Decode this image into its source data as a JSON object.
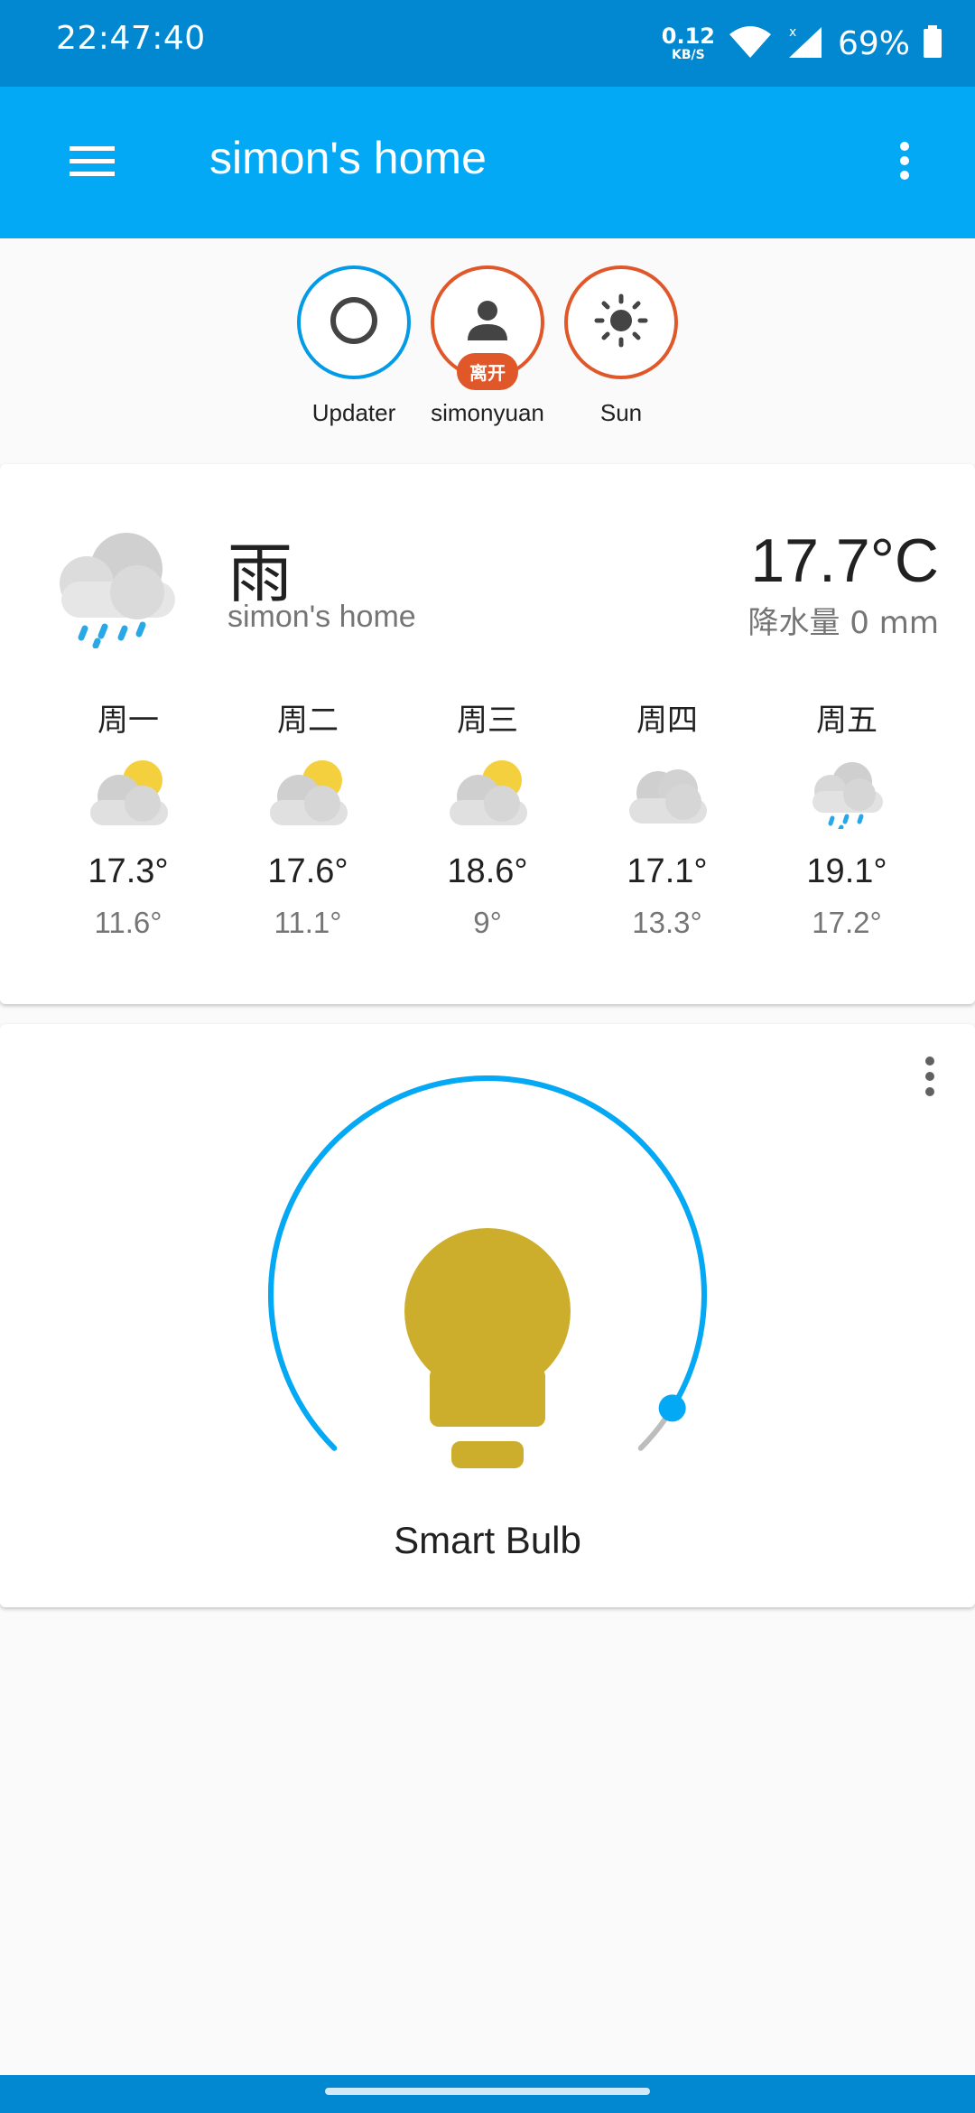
{
  "status_bar": {
    "time": "22:47:40",
    "net_speed_value": "0.12",
    "net_speed_unit": "KB/S",
    "battery_pct": "69%"
  },
  "app_bar": {
    "title": "simon's home",
    "menu_icon": "hamburger-menu-icon",
    "more_icon": "more-vertical-icon"
  },
  "badges": [
    {
      "label": "Updater",
      "icon": "circle-outline-icon",
      "border_color": "#039be5"
    },
    {
      "label": "simonyuan",
      "icon": "person-icon",
      "tag": "离开",
      "border_color": "#e0582a"
    },
    {
      "label": "Sun",
      "icon": "sun-icon",
      "border_color": "#e0582a"
    }
  ],
  "weather": {
    "condition": "雨",
    "location": "simon's home",
    "temperature": "17.7°C",
    "precipitation": "降水量 0 mm",
    "icon": "rain-cloud-icon",
    "forecast": [
      {
        "day": "周一",
        "high": "17.3°",
        "low": "11.6°",
        "icon": "partly-cloudy-icon"
      },
      {
        "day": "周二",
        "high": "17.6°",
        "low": "11.1°",
        "icon": "partly-cloudy-icon"
      },
      {
        "day": "周三",
        "high": "18.6°",
        "low": "9°",
        "icon": "partly-cloudy-icon"
      },
      {
        "day": "周四",
        "high": "17.1°",
        "low": "13.3°",
        "icon": "cloudy-icon"
      },
      {
        "day": "周五",
        "high": "19.1°",
        "low": "17.2°",
        "icon": "rain-cloud-icon"
      }
    ]
  },
  "light": {
    "name": "Smart Bulb",
    "icon": "lightbulb-icon",
    "brightness_fraction": 0.95,
    "colors": {
      "accent": "#03a9f4",
      "bulb": "#cdae2c",
      "track": "#bdbdbd"
    }
  }
}
